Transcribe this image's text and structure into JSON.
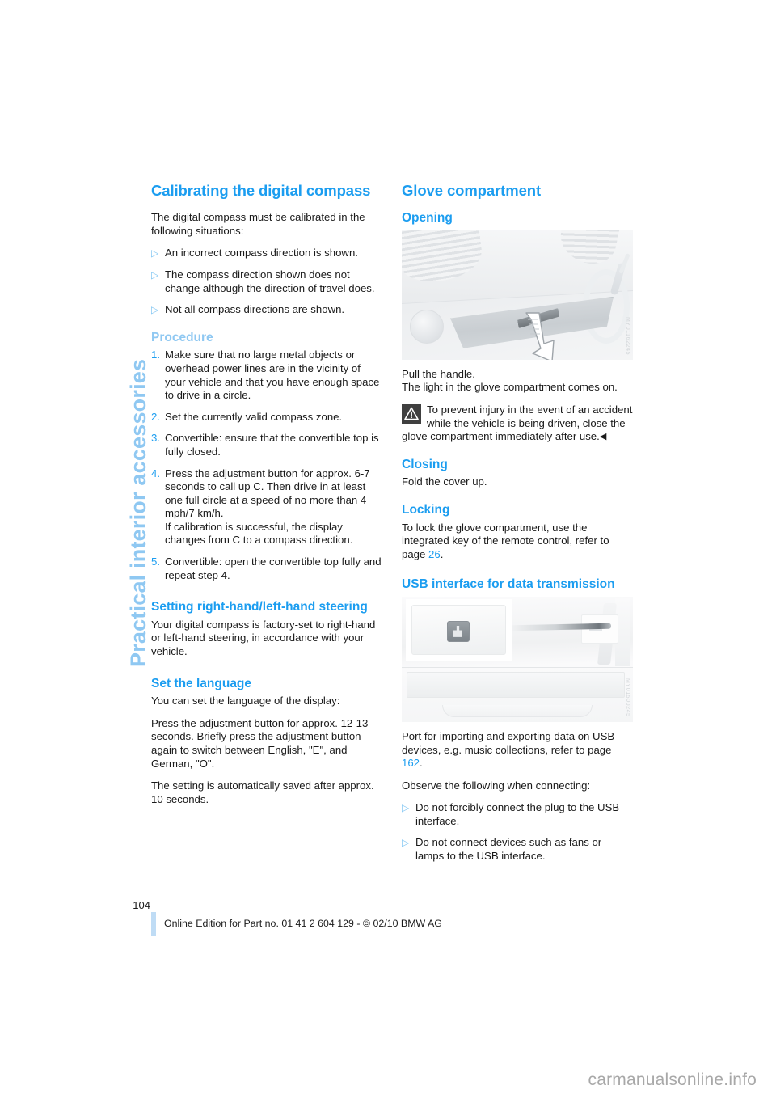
{
  "chapter_tab": "Practical interior accessories",
  "left_column": {
    "compass": {
      "heading": "Calibrating the digital compass",
      "intro": "The digital compass must be calibrated in the following situations:",
      "bullets": [
        "An incorrect compass direction is shown.",
        "The compass direction shown does not change although the direction of travel does.",
        "Not all compass directions are shown."
      ],
      "procedure_heading": "Procedure",
      "steps": [
        {
          "number": "1.",
          "text": "Make sure that no large metal objects or overhead power lines are in the vicinity of your vehicle and that you have enough space to drive in a circle."
        },
        {
          "number": "2.",
          "text": "Set the currently valid compass zone."
        },
        {
          "number": "3.",
          "text": "Convertible: ensure that the convertible top is fully closed."
        },
        {
          "number": "4.",
          "text": "Press the adjustment button for approx. 6-7 seconds to call up C. Then drive in at least one full circle at a speed of no more than 4 mph/7 km/h.\nIf calibration is successful, the display changes from C to a compass direction."
        },
        {
          "number": "5.",
          "text": "Convertible: open the convertible top fully and repeat step 4."
        }
      ]
    },
    "steering": {
      "heading": "Setting right-hand/left-hand steering",
      "text": "Your digital compass is factory-set to right-hand or left-hand steering, in accordance with your vehicle."
    },
    "language": {
      "heading": "Set the language",
      "para1": "You can set the language of the display:",
      "para2": "Press the adjustment button for approx. 12-13 seconds. Briefly press the adjustment button again to switch between English, \"E\", and German, \"O\".",
      "para3": "The setting is automatically saved after approx. 10 seconds."
    }
  },
  "right_column": {
    "glove": {
      "heading": "Glove compartment",
      "opening_heading": "Opening",
      "figure_code": "MY01162245",
      "caption_line1": "Pull the handle.",
      "caption_line2": "The light in the glove compartment comes on.",
      "warning_text": "To prevent injury in the event of an accident while the vehicle is being driven, close the glove compartment immediately after use.",
      "warning_endmark": "◀",
      "closing_heading": "Closing",
      "closing_text": "Fold the cover up.",
      "locking_heading": "Locking",
      "locking_text_before": "To lock the glove compartment, use the integrated key of the remote control, refer to page ",
      "locking_page_ref": "26",
      "locking_text_after": "."
    },
    "usb": {
      "heading": "USB interface for data transmission",
      "figure_code": "MY01500245",
      "text_before": "Port for importing and exporting data on USB devices, e.g. music collections, refer to page ",
      "page_ref": "162",
      "text_after": ".",
      "observe": "Observe the following when connecting:",
      "bullets": [
        "Do not forcibly connect the plug to the USB interface.",
        "Do not connect devices such as fans or lamps to the USB interface."
      ]
    }
  },
  "footer": {
    "page_number": "104",
    "text": "Online Edition for Part no. 01 41 2 604 129 - © 02/10 BMW AG"
  },
  "watermark": "carmanualsonline.info",
  "colors": {
    "heading_blue": "#1b9df0",
    "light_blue": "#8fc8f2",
    "bullet_blue": "#7cc3f2",
    "body_text": "#1a1a1a"
  },
  "bullet_glyph": "▷"
}
